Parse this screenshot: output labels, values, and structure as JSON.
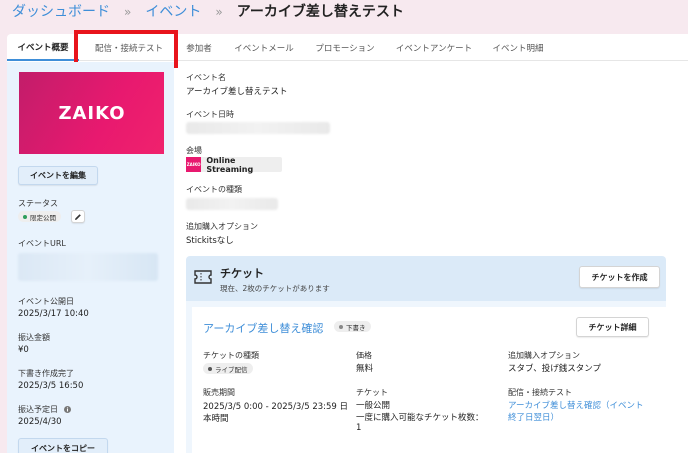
{
  "breadcrumb": {
    "dashboard": "ダッシュボード",
    "events": "イベント",
    "separator": "»",
    "current": "アーカイブ差し替えテスト"
  },
  "tabs": [
    {
      "label": "イベント概要",
      "active": true
    },
    {
      "label": "配信・接続テスト",
      "active": false
    },
    {
      "label": "参加者",
      "active": false
    },
    {
      "label": "イベントメール",
      "active": false
    },
    {
      "label": "プロモーション",
      "active": false
    },
    {
      "label": "イベントアンケート",
      "active": false
    },
    {
      "label": "イベント明細",
      "active": false
    }
  ],
  "sidebar": {
    "logo_text": "ZAIKO",
    "edit_button": "イベントを編集",
    "status_label": "ステータス",
    "status_badge": "限定公開",
    "url_label": "イベントURL",
    "published_label": "イベント公開日",
    "published_value": "2025/3/17 10:40",
    "payout_label": "振込金額",
    "payout_value": "¥0",
    "draft_label": "下書き作成完了",
    "draft_value": "2025/3/5 16:50",
    "scheduled_label": "振込予定日",
    "scheduled_value": "2025/4/30",
    "copy_button": "イベントをコピー"
  },
  "main": {
    "name_label": "イベント名",
    "name_value": "アーカイブ差し替えテスト",
    "datetime_label": "イベント日時",
    "venue_label": "会場",
    "venue_value": "Online Streaming",
    "venue_logo": "ZAIKO",
    "type_label": "イベントの種類",
    "addon_label": "追加購入オプション",
    "addon_value": "Stickitsなし"
  },
  "tickets": {
    "title": "チケット",
    "subtitle": "現在、2枚のチケットがあります",
    "create_button": "チケットを作成",
    "card": {
      "title": "アーカイブ差し替え確認",
      "status": "下書き",
      "detail_button": "チケット詳細",
      "type_label": "チケットの種類",
      "type_badge": "ライブ配信",
      "price_label": "価格",
      "price_value": "無料",
      "addon_label": "追加購入オプション",
      "addon_value": "スタブ、投げ銭スタンプ",
      "sale_label": "販売期間",
      "sale_value_1": "2025/3/5 0:00 - 2025/3/5 23:59 日",
      "sale_value_2": "本時間",
      "ticket_label": "チケット",
      "ticket_value_1": "一般公開",
      "ticket_value_2": "一度に購入可能なチケット枚数：",
      "ticket_value_3": "1",
      "stream_label": "配信・接続テスト",
      "stream_link_1": "アーカイブ差し替え確認（イベント",
      "stream_link_2": "終了日翌日）"
    }
  },
  "colors": {
    "accent": "#3e8ed8",
    "highlight": "#e8141c",
    "brand": "#e8196f",
    "status_dot": "#2e9e5b"
  }
}
